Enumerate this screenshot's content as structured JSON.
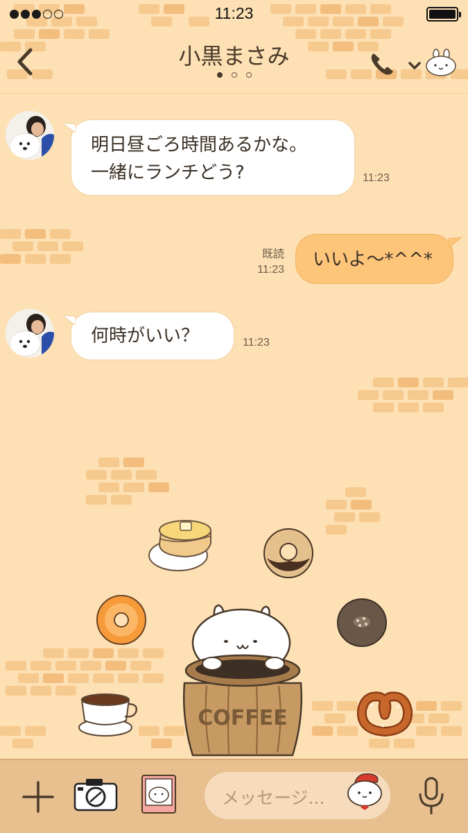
{
  "status_bar": {
    "signal_filled": 3,
    "signal_total": 5,
    "time": "11:23",
    "battery_level": 1.0
  },
  "header": {
    "back_icon": "chevron-left-icon",
    "title": "小黒まさみ",
    "page_dots_total": 3,
    "page_dot_active": 1,
    "call_icon": "phone-icon",
    "menu_icon": "chevron-down-icon",
    "avatar_icon": "bunny-face-icon"
  },
  "messages": [
    {
      "direction": "incoming",
      "lines": [
        "明日昼ごろ時間あるかな。",
        "一緒にランチどう?"
      ],
      "time": "11:23"
    },
    {
      "direction": "outgoing",
      "text": "いいよ〜*^^*",
      "read_label": "既読",
      "time": "11:23"
    },
    {
      "direction": "incoming",
      "text": "何時がいい？",
      "time": "11:23"
    }
  ],
  "background_theme": {
    "text": "COFFEE",
    "items": [
      "pancake",
      "chocolate-donut",
      "orange-donut",
      "glazed-donut",
      "coffee-cup",
      "pretzel",
      "bunny-in-barrel"
    ]
  },
  "input_bar": {
    "plus_icon": "plus-icon",
    "camera_icon": "camera-icon",
    "sticker_icon": "sticker-icon",
    "placeholder": "メッセージ...",
    "emoji_icon": "bunny-emoji-icon",
    "mic_icon": "microphone-icon"
  },
  "colors": {
    "background": "#fde0b4",
    "bubble_outgoing": "#fdc57a",
    "bubble_incoming": "#ffffff",
    "input_bar": "#e8bf8f"
  }
}
